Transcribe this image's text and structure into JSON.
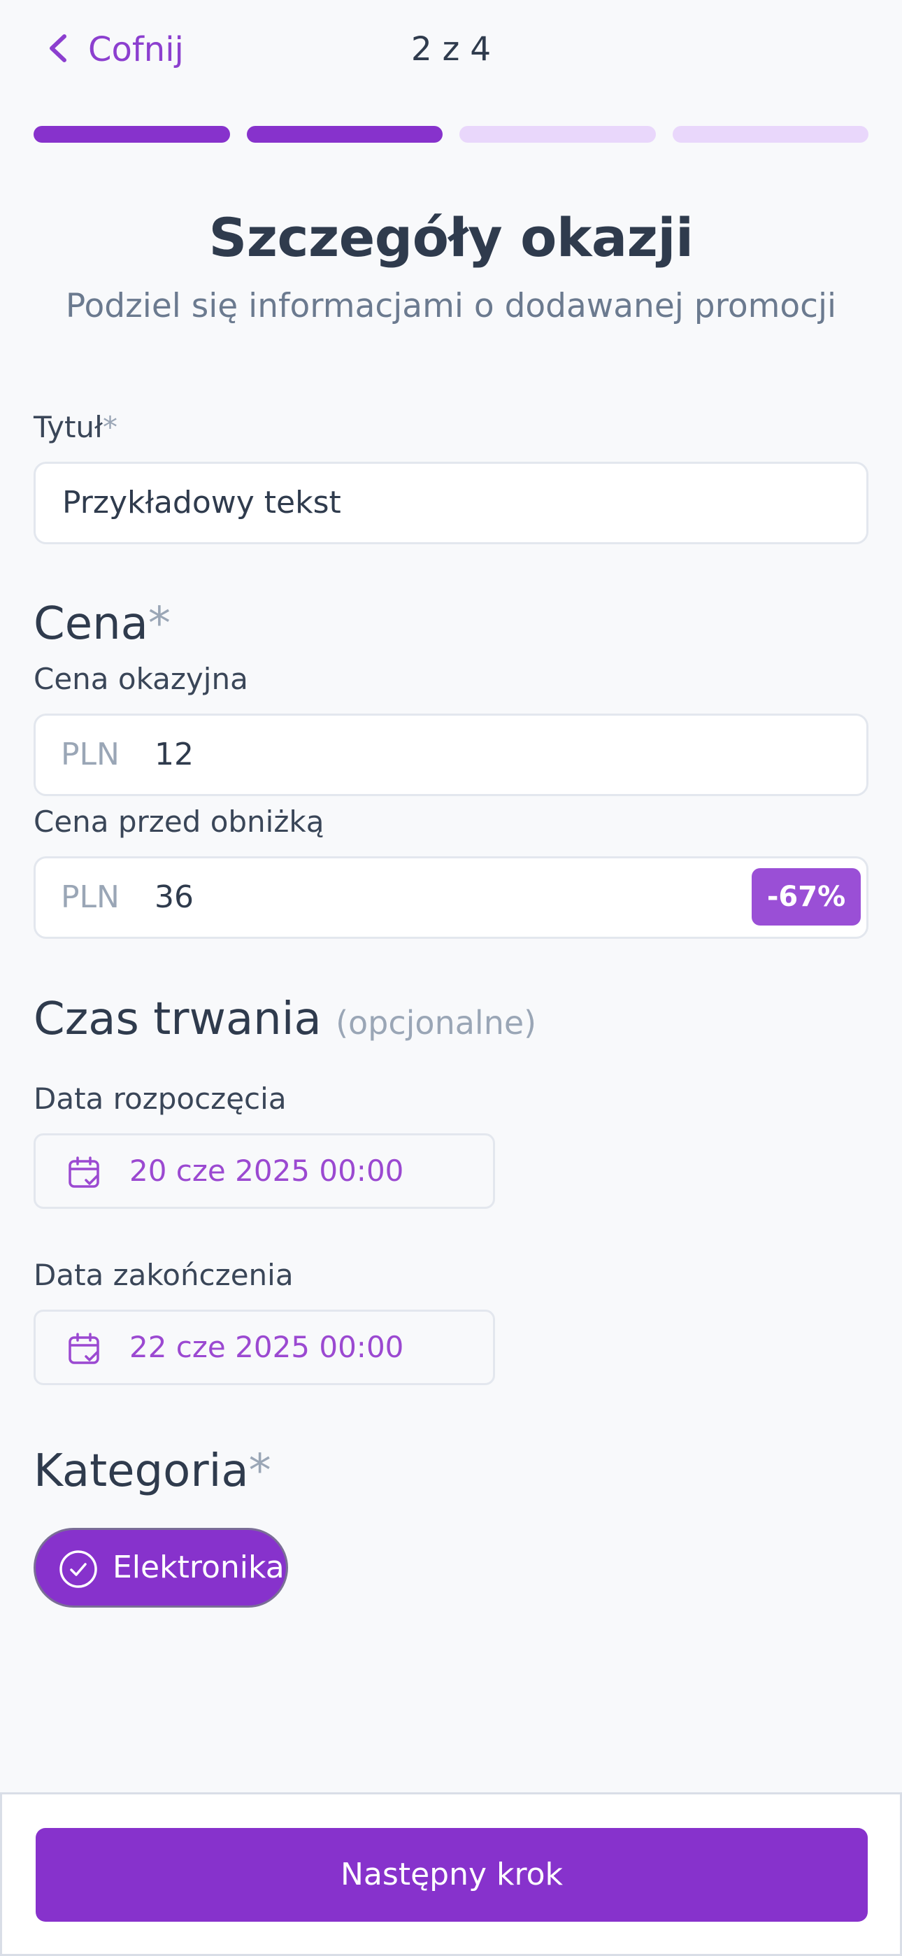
{
  "header": {
    "back_label": "Cofnij",
    "step_counter": "2 z 4"
  },
  "progress": {
    "current_step": 2,
    "total_steps": 4
  },
  "page": {
    "title": "Szczegóły okazji",
    "subtitle": "Podziel się informacjami o dodawanej promocji"
  },
  "title_field": {
    "label": "Tytuł",
    "required_mark": "*",
    "value": "Przykładowy tekst"
  },
  "price": {
    "section_title": "Cena",
    "required_mark": "*",
    "deal_price": {
      "label": "Cena okazyjna",
      "currency": "PLN",
      "value": "12"
    },
    "original_price": {
      "label": "Cena przed obniżką",
      "currency": "PLN",
      "value": "36"
    },
    "discount_badge": "-67%"
  },
  "duration": {
    "section_title": "Czas trwania",
    "optional_note": "(opcjonalne)",
    "start": {
      "label": "Data rozpoczęcia",
      "value": "20 cze 2025 00:00"
    },
    "end": {
      "label": "Data zakończenia",
      "value": "22 cze 2025 00:00"
    }
  },
  "category": {
    "section_title": "Kategoria",
    "required_mark": "*",
    "selected": "Elektronika"
  },
  "footer": {
    "next_label": "Następny krok"
  },
  "colors": {
    "accent": "#8732cc",
    "accent_light": "#e9d7fb",
    "badge": "#9a4fd6",
    "text": "#2f3b4d",
    "muted": "#9aa6b6"
  },
  "icons": [
    "chevron-left-icon",
    "calendar-check-icon",
    "check-circle-icon"
  ]
}
